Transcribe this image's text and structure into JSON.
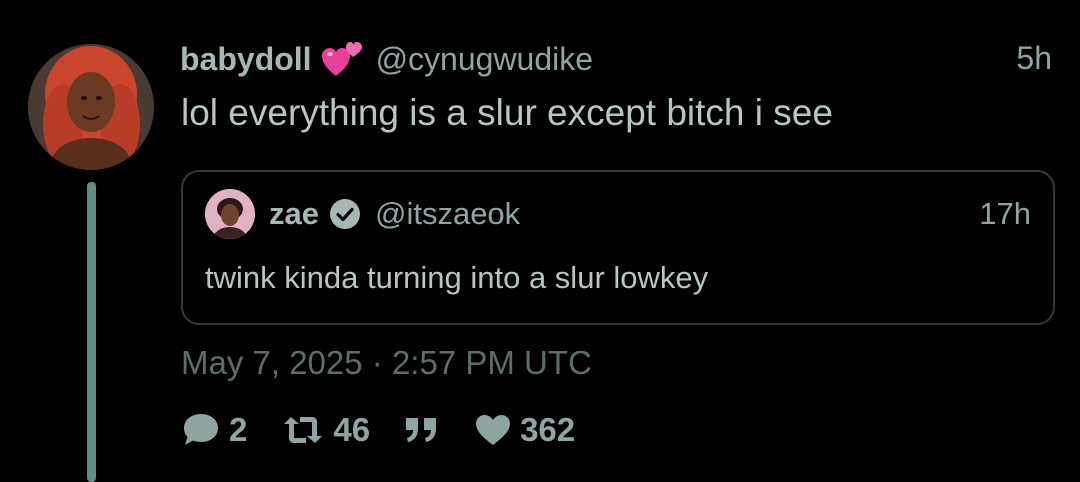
{
  "post": {
    "author": {
      "display_name": "babydoll",
      "emoji": "two-hearts-emoji",
      "handle": "@cynugwudike"
    },
    "time_ago": "5h",
    "text": "lol everything is a slur except bitch i see",
    "quote": {
      "author": {
        "display_name": "zae",
        "verified": true,
        "handle": "@itszaeok"
      },
      "time_ago": "17h",
      "text": "twink kinda turning into a slur lowkey"
    },
    "date_line": "May 7, 2025 · 2:57 PM UTC",
    "actions": {
      "replies": "2",
      "reposts": "46",
      "quotes_icon": "quote-icon",
      "likes": "362"
    }
  },
  "colors": {
    "background": "#000000",
    "text": "#a6b8b6",
    "muted": "#8fa5a3",
    "dim": "#5b6e6c",
    "thread_line": "#5f8b89",
    "card_border": "#323a3a",
    "heart_emoji": "#e8419a"
  },
  "icons": [
    "comment-icon",
    "retweet-icon",
    "quote-icon",
    "heart-icon",
    "verified-badge-icon",
    "two-hearts-emoji"
  ]
}
